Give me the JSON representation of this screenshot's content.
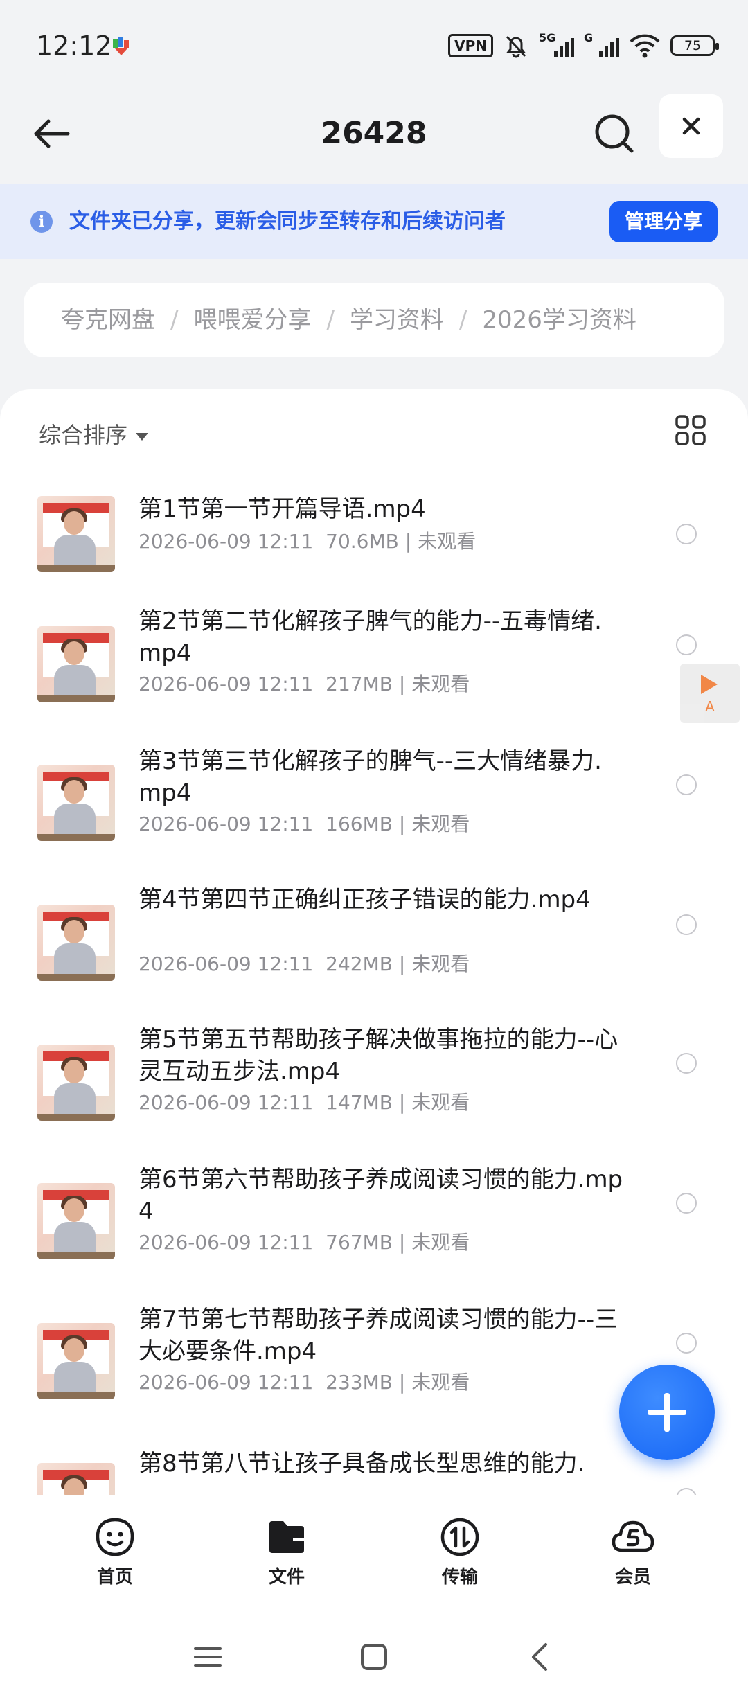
{
  "status_bar": {
    "time": "12:12",
    "vpn": "VPN",
    "sim1_tag": "5G",
    "sim2_tag": "G",
    "battery": "75"
  },
  "header": {
    "title": "26428"
  },
  "share_banner": {
    "message": "文件夹已分享，更新会同步至转存和后续访问者",
    "manage_label": "管理分享"
  },
  "breadcrumb": [
    "夸克网盘",
    "喂喂爱分享",
    "学习资料",
    "2026学习资料"
  ],
  "sort": {
    "label": "综合排序"
  },
  "files": [
    {
      "name": "第1节第一节开篇导语.mp4",
      "date": "2026-06-09 12:11",
      "size": "70.6MB",
      "status": "未观看"
    },
    {
      "name": "第2节第二节化解孩子脾气的能力--五毒情绪.mp4",
      "date": "2026-06-09 12:11",
      "size": "217MB",
      "status": "未观看"
    },
    {
      "name": "第3节第三节化解孩子的脾气--三大情绪暴力.mp4",
      "date": "2026-06-09 12:11",
      "size": "166MB",
      "status": "未观看"
    },
    {
      "name": "第4节第四节正确纠正孩子错误的能力.mp4",
      "date": "2026-06-09 12:11",
      "size": "242MB",
      "status": "未观看"
    },
    {
      "name": "第5节第五节帮助孩子解决做事拖拉的能力--心灵互动五步法.mp4",
      "date": "2026-06-09 12:11",
      "size": "147MB",
      "status": "未观看"
    },
    {
      "name": "第6节第六节帮助孩子养成阅读习惯的能力.mp4",
      "date": "2026-06-09 12:11",
      "size": "767MB",
      "status": "未观看"
    },
    {
      "name": "第7节第七节帮助孩子养成阅读习惯的能力--三大必要条件.mp4",
      "date": "2026-06-09 12:11",
      "size": "233MB",
      "status": "未观看"
    },
    {
      "name": "第8节第八节让孩子具备成长型思维的能力.",
      "date": "",
      "size": "",
      "status": ""
    }
  ],
  "floating_widget": {
    "label": "A"
  },
  "tabs": [
    {
      "label": "首页",
      "icon": "smile-face-icon"
    },
    {
      "label": "文件",
      "icon": "folder-icon"
    },
    {
      "label": "传输",
      "icon": "transfer-icon"
    },
    {
      "label": "会员",
      "icon": "vip-cloud-icon"
    }
  ],
  "colors": {
    "accent": "#1a5cf4",
    "banner_bg": "#e6ecfb",
    "banner_text": "#2a5de6",
    "page_bg": "#f2f3f5"
  }
}
